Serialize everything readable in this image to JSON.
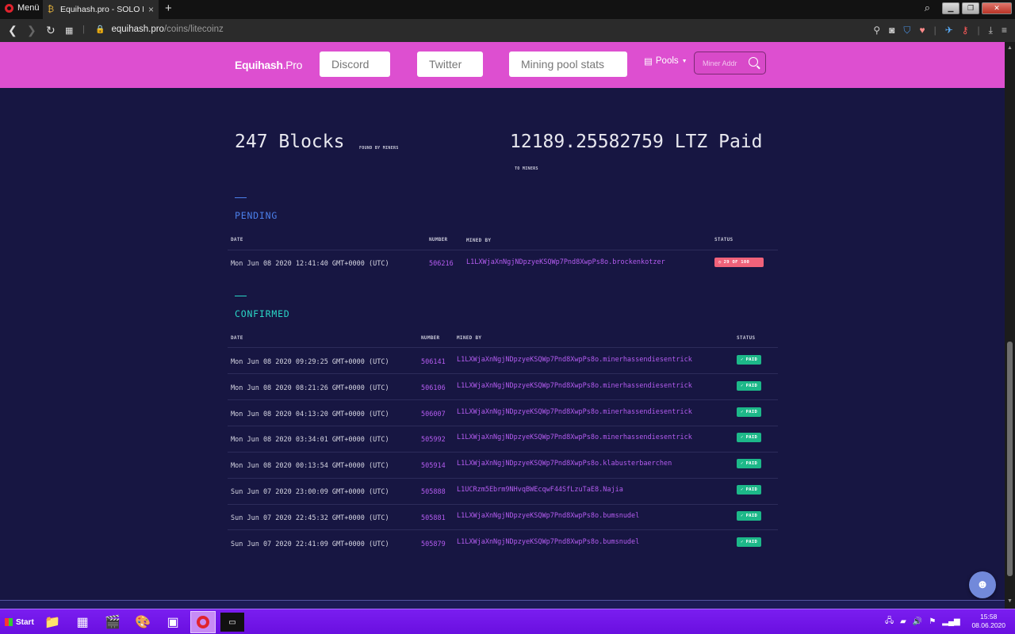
{
  "browser": {
    "menu_label": "Menü",
    "tab_title": "Equihash.pro - SOLO Mining",
    "tab_close": "×",
    "new_tab": "+",
    "url_host": "equihash.pro",
    "url_path": "/coins/litecoinz"
  },
  "nav": {
    "brand_main": "Equihash",
    "brand_suffix": ".Pro",
    "discord": "Discord",
    "twitter": "Twitter",
    "stats": "Mining pool stats",
    "pools": "Pools",
    "search_placeholder": "Miner Addr"
  },
  "stats": {
    "blocks": "247 Blocks",
    "blocks_caption": "FOUND BY MINERS",
    "paid": "12189.25582759 LTZ Paid",
    "paid_caption": "TO MINERS"
  },
  "pending": {
    "title": "PENDING",
    "headers": {
      "date": "DATE",
      "number": "NUMBER",
      "mined_by": "MINED BY",
      "status": "STATUS"
    },
    "rows": [
      {
        "date": "Mon Jun 08 2020 12:41:40 GMT+0000 (UTC)",
        "number": "506216",
        "miner": "L1LXWjaXnNgjNDpzyeKSQWp7Pnd8XwpPs8o.brockenkotzer",
        "status": "29 OF 100"
      }
    ]
  },
  "confirmed": {
    "title": "CONFIRMED",
    "headers": {
      "date": "DATE",
      "number": "NUMBER",
      "mined_by": "MINED BY",
      "status": "STATUS"
    },
    "rows": [
      {
        "date": "Mon Jun 08 2020 09:29:25 GMT+0000 (UTC)",
        "number": "506141",
        "miner": "L1LXWjaXnNgjNDpzyeKSQWp7Pnd8XwpPs8o.minerhassendiesentrick",
        "status": "PAID"
      },
      {
        "date": "Mon Jun 08 2020 08:21:26 GMT+0000 (UTC)",
        "number": "506106",
        "miner": "L1LXWjaXnNgjNDpzyeKSQWp7Pnd8XwpPs8o.minerhassendiesentrick",
        "status": "PAID"
      },
      {
        "date": "Mon Jun 08 2020 04:13:20 GMT+0000 (UTC)",
        "number": "506007",
        "miner": "L1LXWjaXnNgjNDpzyeKSQWp7Pnd8XwpPs8o.minerhassendiesentrick",
        "status": "PAID"
      },
      {
        "date": "Mon Jun 08 2020 03:34:01 GMT+0000 (UTC)",
        "number": "505992",
        "miner": "L1LXWjaXnNgjNDpzyeKSQWp7Pnd8XwpPs8o.minerhassendiesentrick",
        "status": "PAID"
      },
      {
        "date": "Mon Jun 08 2020 00:13:54 GMT+0000 (UTC)",
        "number": "505914",
        "miner": "L1LXWjaXnNgjNDpzyeKSQWp7Pnd8XwpPs8o.klabusterbaerchen",
        "status": "PAID"
      },
      {
        "date": "Sun Jun 07 2020 23:00:09 GMT+0000 (UTC)",
        "number": "505888",
        "miner": "L1UCRzm5Ebrm9NHvqBWEcqwF44SfLzuTaE8.Najia",
        "status": "PAID"
      },
      {
        "date": "Sun Jun 07 2020 22:45:32 GMT+0000 (UTC)",
        "number": "505881",
        "miner": "L1LXWjaXnNgjNDpzyeKSQWp7Pnd8XwpPs8o.bumsnudel",
        "status": "PAID"
      },
      {
        "date": "Sun Jun 07 2020 22:41:09 GMT+0000 (UTC)",
        "number": "505879",
        "miner": "L1LXWjaXnNgjNDpzyeKSQWp7Pnd8XwpPs8o.bumsnudel",
        "status": "PAID"
      }
    ]
  },
  "taskbar": {
    "start": "Start",
    "time": "15:58",
    "date": "08.06.2020"
  },
  "colors": {
    "nav_bg": "#dd4fd0",
    "page_bg": "#171642",
    "pending_accent": "#4b7fea",
    "confirmed_accent": "#2ad6c6",
    "paid_badge": "#1db889",
    "pending_badge": "#f0627a",
    "link_purple": "#b45cf0"
  }
}
